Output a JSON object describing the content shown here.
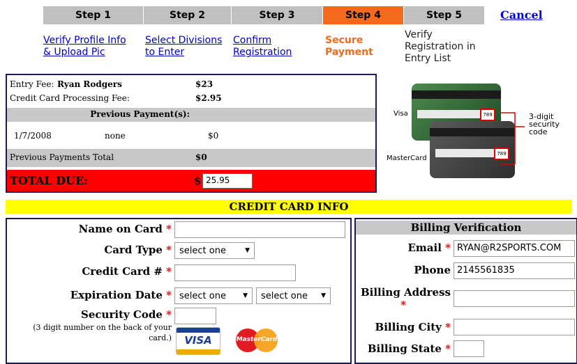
{
  "steps": [
    {
      "label": "Step 1",
      "desc_line1": "Verify Profile Info",
      "desc_line2": "& Upload Pic"
    },
    {
      "label": "Step 2",
      "desc_line1": "Select Divisions",
      "desc_line2": "to Enter"
    },
    {
      "label": "Step 3",
      "desc_line1": "Confirm",
      "desc_line2": "Registration"
    },
    {
      "label": "Step 4",
      "desc_line1": "Secure",
      "desc_line2": "Payment"
    },
    {
      "label": "Step 5",
      "desc_line1": "Verify",
      "desc_line2": "Registration in",
      "desc_line3": "Entry List"
    }
  ],
  "active_step": 4,
  "cancel_label": "Cancel",
  "fees": {
    "entry_fee_label": "Entry Fee: ",
    "entry_fee_name": "Ryan Rodgers",
    "entry_fee_amount": "$23",
    "processing_label": "Credit Card Processing Fee:",
    "processing_amount": "$2.95",
    "previous_header": "Previous Payment(s):",
    "previous_rows": [
      {
        "date": "1/7/2008",
        "note": "none",
        "amount": "$0"
      }
    ],
    "previous_total_label": "Previous Payments Total",
    "previous_total_amount": "$0",
    "total_due_label": "TOTAL DUE:",
    "total_due_currency": "$",
    "total_due_value": "25.95"
  },
  "card_graphic": {
    "visa_label": "Visa",
    "mastercard_label": "MasterCard",
    "callout_line1": "3-digit",
    "callout_line2": "security",
    "callout_line3": "code",
    "code_visa": "789",
    "code_mc": "789"
  },
  "credit_card_info": {
    "banner": "CREDIT CARD INFO",
    "name_on_card_label": "Name on Card",
    "name_on_card_value": "",
    "card_type_label": "Card Type",
    "card_type_selected": "select one",
    "card_number_label": "Credit Card #",
    "card_number_value": "",
    "expiration_label": "Expiration Date",
    "exp_month_selected": "select one",
    "exp_year_selected": "select one",
    "security_code_label": "Security Code",
    "security_code_hint1": "(3 digit number on the back of your",
    "security_code_hint2": "card.)",
    "security_code_value": "",
    "visa_logo": "VISA",
    "mastercard_logo": "MasterCard",
    "required_mark": "*"
  },
  "billing": {
    "header": "Billing Verification",
    "email_label": "Email",
    "email_value": "RYAN@R2SPORTS.COM",
    "phone_label": "Phone",
    "phone_value": "2145561835",
    "address_label": "Billing Address",
    "address_value": "",
    "city_label": "Billing City",
    "city_value": "",
    "state_label": "Billing State",
    "state_value": ""
  },
  "colors": {
    "active_step": "#f26b1d",
    "inactive_step": "#c0c0c0",
    "link": "#0000cc",
    "total_due_bg": "#ff0000",
    "banner_bg": "#ffff00",
    "gray_row": "#c8c8c8",
    "required": "#e00000"
  }
}
